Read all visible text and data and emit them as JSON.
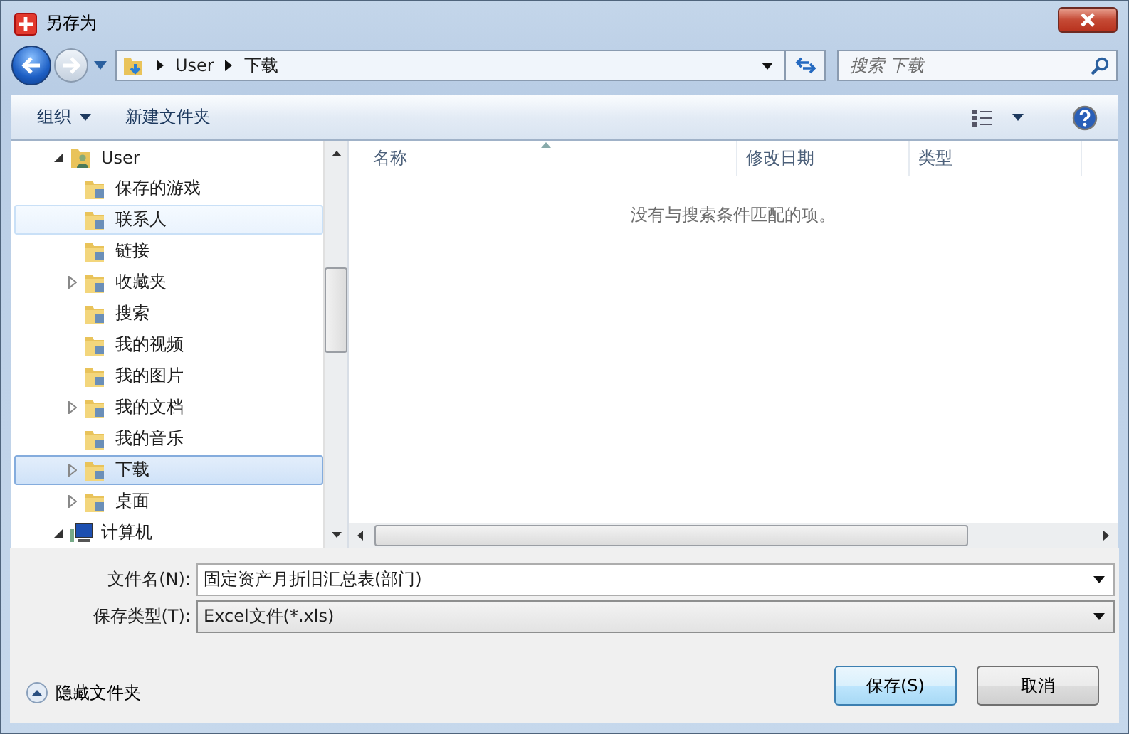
{
  "window": {
    "title": "另存为"
  },
  "address": {
    "path": [
      "User",
      "下载"
    ]
  },
  "search": {
    "placeholder": "搜索 下载"
  },
  "toolbar": {
    "organize": "组织",
    "new_folder": "新建文件夹"
  },
  "tree": [
    {
      "label": "User",
      "kind": "user",
      "expandable": true,
      "expanded": true,
      "highlighted": false,
      "selected": false,
      "children": [
        {
          "label": "保存的游戏",
          "kind": "folder",
          "expandable": false,
          "highlighted": false,
          "selected": false
        },
        {
          "label": "联系人",
          "kind": "folder",
          "expandable": false,
          "highlighted": true,
          "selected": false
        },
        {
          "label": "链接",
          "kind": "folder",
          "expandable": false,
          "highlighted": false,
          "selected": false
        },
        {
          "label": "收藏夹",
          "kind": "folder",
          "expandable": true,
          "expanded": false,
          "highlighted": false,
          "selected": false
        },
        {
          "label": "搜索",
          "kind": "folder",
          "expandable": false,
          "highlighted": false,
          "selected": false
        },
        {
          "label": "我的视频",
          "kind": "folder",
          "expandable": false,
          "highlighted": false,
          "selected": false
        },
        {
          "label": "我的图片",
          "kind": "folder",
          "expandable": false,
          "highlighted": false,
          "selected": false
        },
        {
          "label": "我的文档",
          "kind": "folder",
          "expandable": true,
          "expanded": false,
          "highlighted": false,
          "selected": false
        },
        {
          "label": "我的音乐",
          "kind": "folder",
          "expandable": false,
          "highlighted": false,
          "selected": false
        },
        {
          "label": "下载",
          "kind": "folder",
          "expandable": true,
          "expanded": false,
          "highlighted": false,
          "selected": true
        },
        {
          "label": "桌面",
          "kind": "folder",
          "expandable": true,
          "expanded": false,
          "highlighted": false,
          "selected": false
        }
      ]
    },
    {
      "label": "计算机",
      "kind": "computer",
      "expandable": true,
      "expanded": true,
      "highlighted": false,
      "selected": false
    }
  ],
  "file_list": {
    "columns": [
      "名称",
      "修改日期",
      "类型"
    ],
    "empty_message": "没有与搜索条件匹配的项。"
  },
  "form": {
    "filename_label": "文件名(N):",
    "filename": "固定资产月折旧汇总表(部门)",
    "type_label": "保存类型(T):",
    "type": "Excel文件(*.xls)"
  },
  "footer": {
    "hide_folders": "隐藏文件夹",
    "buttons": [
      "保存(S)",
      "取消"
    ]
  }
}
